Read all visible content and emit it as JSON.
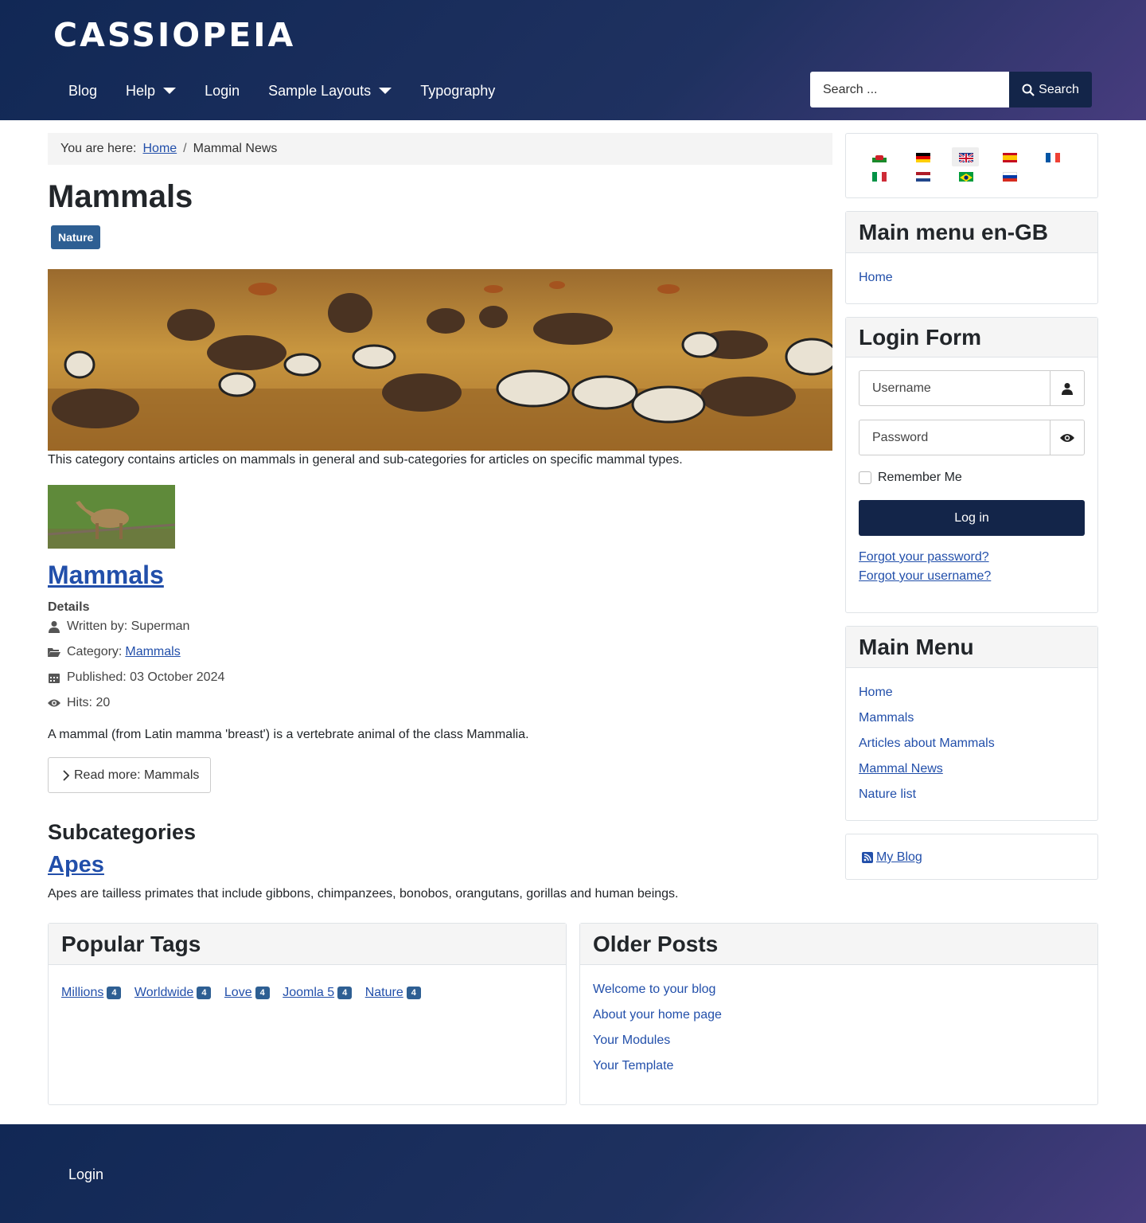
{
  "site": {
    "brand": "CASSIOPEIA"
  },
  "nav": {
    "items": [
      {
        "label": "Blog"
      },
      {
        "label": "Help",
        "dropdown": true
      },
      {
        "label": "Login"
      },
      {
        "label": "Sample Layouts",
        "dropdown": true
      },
      {
        "label": "Typography"
      }
    ]
  },
  "search": {
    "placeholder": "Search ...",
    "button_label": "Search"
  },
  "breadcrumb": {
    "prefix": "You are here:",
    "home": "Home",
    "separator": "/",
    "current": "Mammal News"
  },
  "category": {
    "title": "Mammals",
    "tag": "Nature",
    "description": "This category contains articles on mammals in general and sub-categories for articles on specific mammal types."
  },
  "article": {
    "title": "Mammals",
    "details_label": "Details",
    "written_by": "Written by: Superman",
    "category_prefix": "Category:",
    "category_link": "Mammals",
    "published": "Published: 03 October 2024",
    "hits": "Hits: 20",
    "intro": "A mammal (from Latin mamma 'breast') is a vertebrate animal of the class Mammalia.",
    "read_more": "Read more: Mammals"
  },
  "subcategories": {
    "heading": "Subcategories",
    "items": [
      {
        "title": "Apes",
        "description": "Apes are tailless primates that include gibbons, chimpanzees, bonobos, orangutans, gorillas and human beings."
      }
    ]
  },
  "languages": [
    "Welsh",
    "German",
    "English (UK)",
    "Spanish",
    "French",
    "Italian",
    "Dutch",
    "Portuguese (Brazil)",
    "Russian"
  ],
  "main_menu_en": {
    "title": "Main menu en-GB",
    "items": [
      "Home"
    ]
  },
  "login_form": {
    "title": "Login Form",
    "username_placeholder": "Username",
    "password_placeholder": "Password",
    "remember": "Remember Me",
    "button": "Log in",
    "forgot_password": "Forgot your password?",
    "forgot_username": "Forgot your username?"
  },
  "main_menu": {
    "title": "Main Menu",
    "items": [
      "Home",
      "Mammals",
      "Articles about Mammals",
      "Mammal News",
      "Nature list"
    ]
  },
  "feed": {
    "label": "My Blog"
  },
  "popular_tags": {
    "title": "Popular Tags",
    "items": [
      {
        "label": "Millions",
        "count": "4"
      },
      {
        "label": "Worldwide",
        "count": "4"
      },
      {
        "label": "Love",
        "count": "4"
      },
      {
        "label": "Joomla 5",
        "count": "4"
      },
      {
        "label": "Nature",
        "count": "4"
      }
    ]
  },
  "older_posts": {
    "title": "Older Posts",
    "items": [
      "Welcome to your blog",
      "About your home page",
      "Your Modules",
      "Your Template"
    ]
  },
  "footer": {
    "login": "Login"
  },
  "colors": {
    "header_start": "#112855",
    "header_end": "#473c7e",
    "link": "#224faa",
    "badge": "#2e5f93",
    "button": "#132549"
  }
}
